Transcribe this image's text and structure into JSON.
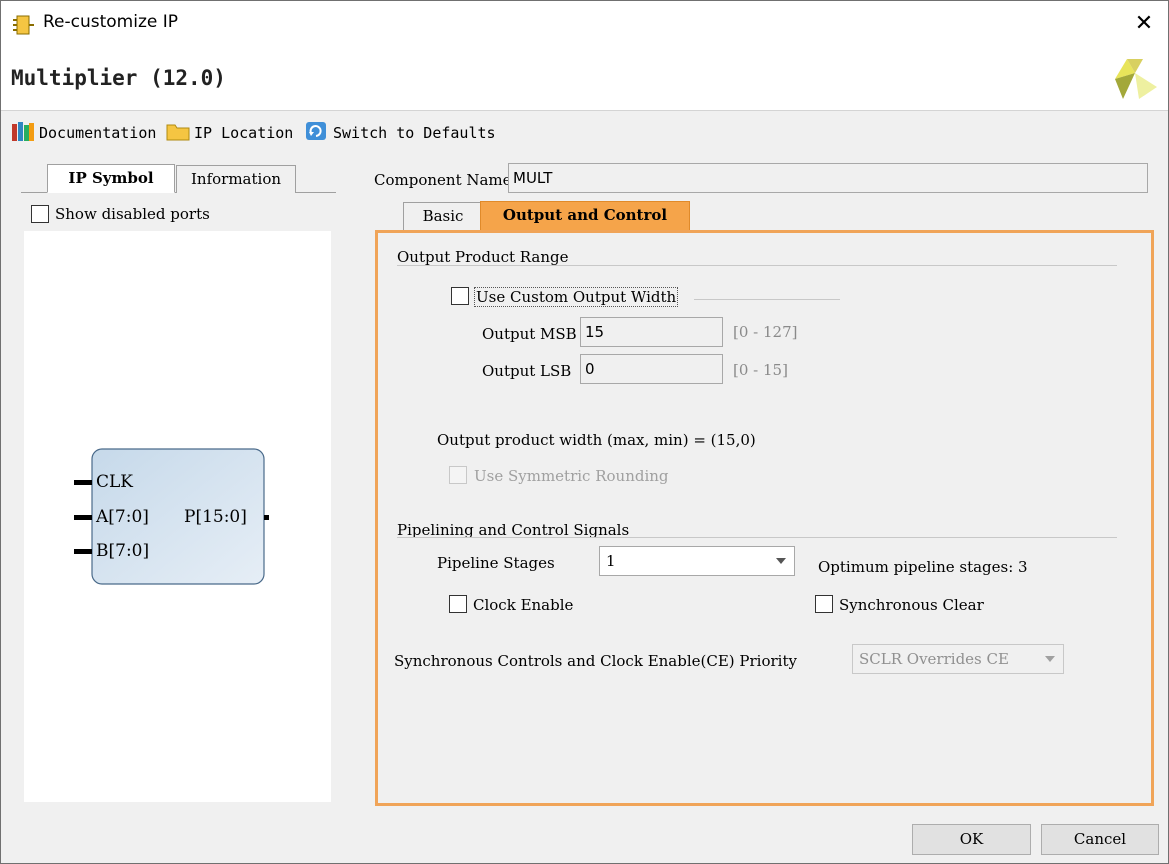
{
  "window": {
    "title": "Re-customize IP",
    "close_icon": "close-icon"
  },
  "header": {
    "title": "Multiplier (12.0)",
    "logo_icon": "xilinx-logo-icon"
  },
  "toolbar": {
    "documentation": "Documentation",
    "ip_location": "IP Location",
    "switch_defaults": "Switch to Defaults"
  },
  "left_panel": {
    "tabs": [
      "IP Symbol",
      "Information"
    ],
    "active_tab": "IP Symbol",
    "show_disabled_ports": "Show disabled ports",
    "symbol": {
      "ports_in": [
        "CLK",
        "A[7:0]",
        "B[7:0]"
      ],
      "port_out": "P[15:0]"
    }
  },
  "component": {
    "label": "Component Name",
    "value": "MULT"
  },
  "right_tabs": [
    "Basic",
    "Output and Control"
  ],
  "active_right_tab": "Output and Control",
  "output_range": {
    "section_title": "Output Product Range",
    "custom_width_label": "Use Custom Output Width",
    "msb_label": "Output MSB",
    "msb_value": "15",
    "msb_range": "[0 - 127]",
    "lsb_label": "Output LSB",
    "lsb_value": "0",
    "lsb_range": "[0 - 15]",
    "width_text": "Output product width (max, min) = (15,0)",
    "symmetric_label": "Use Symmetric Rounding"
  },
  "pipelining": {
    "section_title": "Pipelining and Control Signals",
    "stages_label": "Pipeline Stages",
    "stages_value": "1",
    "optimum_text": "Optimum pipeline stages: 3",
    "clock_enable_label": "Clock Enable",
    "sync_clear_label": "Synchronous Clear",
    "priority_label": "Synchronous Controls and Clock Enable(CE) Priority",
    "priority_value": "SCLR Overrides CE"
  },
  "buttons": {
    "ok": "OK",
    "cancel": "Cancel"
  },
  "colors": {
    "active_tab": "#f5a44a",
    "panel_border": "#f0a458",
    "symbol_fill": "#dbe7f2"
  }
}
